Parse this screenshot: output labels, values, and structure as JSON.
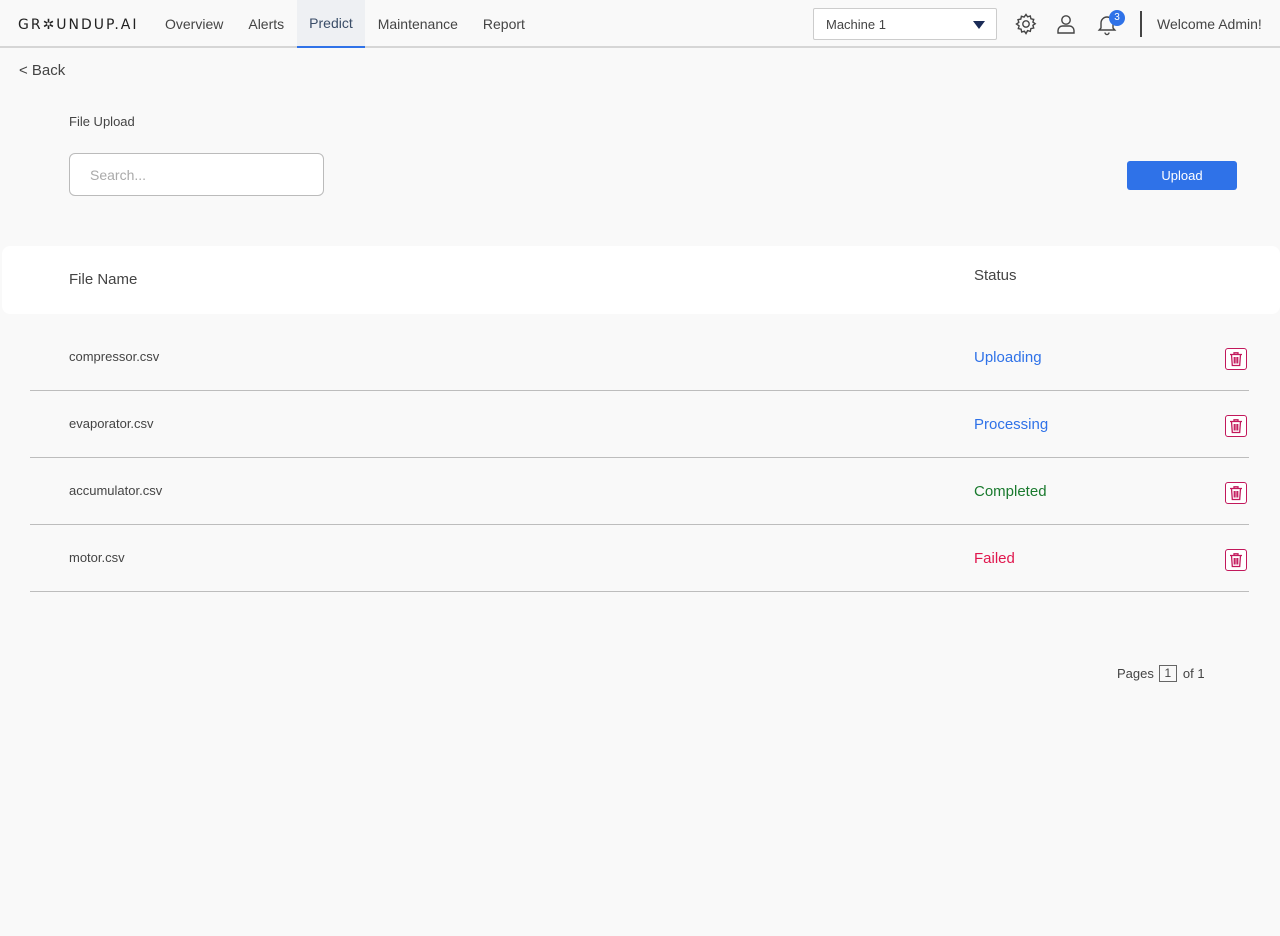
{
  "header": {
    "logo": "GR✲UNDUP.AI",
    "nav": [
      {
        "label": "Overview"
      },
      {
        "label": "Alerts"
      },
      {
        "label": "Predict",
        "active": true
      },
      {
        "label": "Maintenance"
      },
      {
        "label": "Report"
      }
    ],
    "machine_select": "Machine 1",
    "notification_count": "3",
    "welcome": "Welcome Admin!"
  },
  "page": {
    "back_label": "< Back",
    "section_title": "File Upload",
    "search_placeholder": "Search...",
    "upload_label": "Upload"
  },
  "table": {
    "columns": {
      "file_name": "File Name",
      "status": "Status"
    },
    "rows": [
      {
        "file": "compressor.csv",
        "status": "Uploading",
        "status_color": "#2f72e8"
      },
      {
        "file": "evaporator.csv",
        "status": "Processing",
        "status_color": "#2f72e8"
      },
      {
        "file": "accumulator.csv",
        "status": "Completed",
        "status_color": "#1a7a2e"
      },
      {
        "file": "motor.csv",
        "status": "Failed",
        "status_color": "#e0174e"
      }
    ]
  },
  "pagination": {
    "prefix": "Pages",
    "current": "1",
    "suffix": "of 1"
  },
  "colors": {
    "accent": "#2f72e8",
    "delete": "#c2185b"
  }
}
